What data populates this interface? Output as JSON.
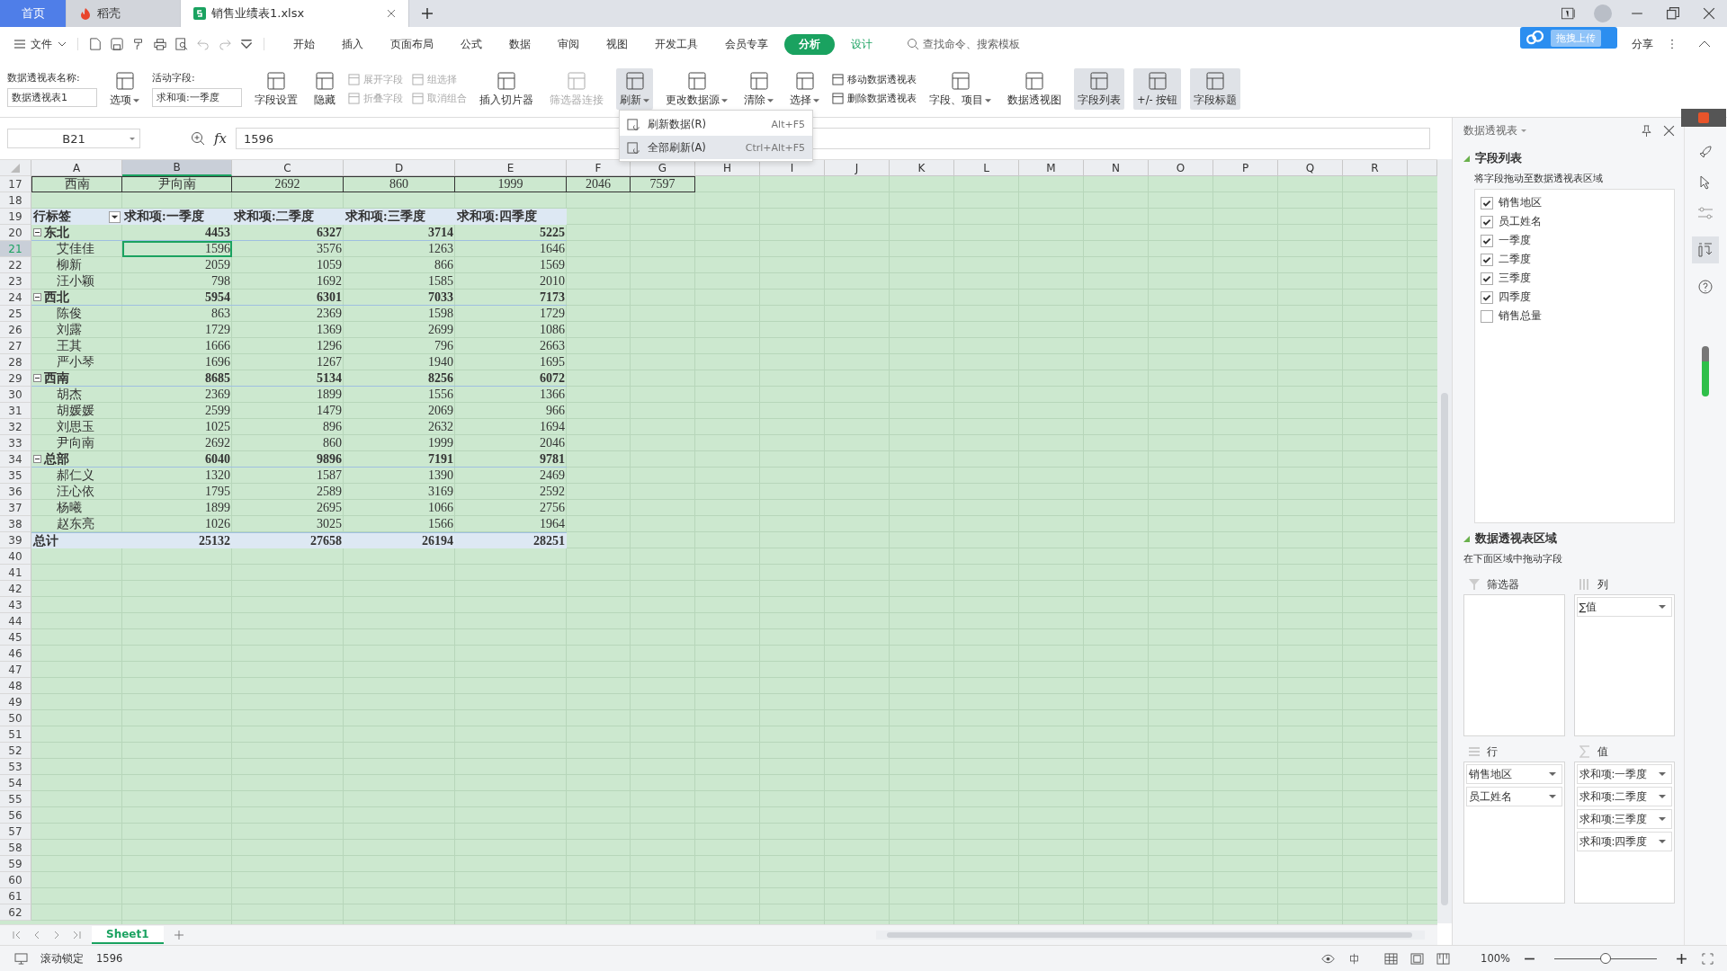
{
  "tabs": [
    {
      "label": "首页",
      "selected": false,
      "kind": "home"
    },
    {
      "label": "稻壳",
      "selected": false,
      "kind": "docer"
    },
    {
      "label": "销售业绩表1.xlsx",
      "selected": true,
      "kind": "sheet"
    }
  ],
  "menu": {
    "file": "文件",
    "items": [
      {
        "label": "开始",
        "selected": false,
        "contextual": false
      },
      {
        "label": "插入",
        "selected": false,
        "contextual": false
      },
      {
        "label": "页面布局",
        "selected": false,
        "contextual": false
      },
      {
        "label": "公式",
        "selected": false,
        "contextual": false
      },
      {
        "label": "数据",
        "selected": false,
        "contextual": false
      },
      {
        "label": "审阅",
        "selected": false,
        "contextual": false
      },
      {
        "label": "视图",
        "selected": false,
        "contextual": false
      },
      {
        "label": "开发工具",
        "selected": false,
        "contextual": false
      },
      {
        "label": "会员专享",
        "selected": false,
        "contextual": false
      },
      {
        "label": "分析",
        "selected": true,
        "contextual": true
      },
      {
        "label": "设计",
        "selected": false,
        "contextual": true
      }
    ],
    "search": "查找命令、搜索模板",
    "share": "分享",
    "upload": "拖拽上传"
  },
  "ribbon": [
    {
      "kind": "name",
      "label": "数据透视表名称:",
      "value": "数据透视表1"
    },
    {
      "kind": "big",
      "label": "选项",
      "dropdown": true,
      "disabled": false,
      "selected": false
    },
    {
      "kind": "name",
      "label": "活动字段:",
      "value": "求和项:一季度"
    },
    {
      "kind": "big",
      "label": "字段设置",
      "dropdown": false,
      "disabled": false,
      "selected": false
    },
    {
      "kind": "big",
      "label": "隐藏",
      "dropdown": false,
      "disabled": false,
      "selected": false
    },
    {
      "kind": "stack",
      "items": [
        {
          "label": "展开字段",
          "disabled": true
        },
        {
          "label": "折叠字段",
          "disabled": true
        }
      ]
    },
    {
      "kind": "stack",
      "items": [
        {
          "label": "组选择",
          "disabled": true
        },
        {
          "label": "取消组合",
          "disabled": true
        }
      ]
    },
    {
      "kind": "big",
      "label": "插入切片器",
      "dropdown": false,
      "disabled": false,
      "selected": false
    },
    {
      "kind": "big",
      "label": "筛选器连接",
      "dropdown": false,
      "disabled": true,
      "selected": false
    },
    {
      "kind": "big",
      "label": "刷新",
      "dropdown": true,
      "disabled": false,
      "selected": true
    },
    {
      "kind": "big",
      "label": "更改数据源",
      "dropdown": true,
      "disabled": false,
      "selected": false
    },
    {
      "kind": "big",
      "label": "清除",
      "dropdown": true,
      "disabled": false,
      "selected": false
    },
    {
      "kind": "big",
      "label": "选择",
      "dropdown": true,
      "disabled": false,
      "selected": false
    },
    {
      "kind": "stack",
      "items": [
        {
          "label": "移动数据透视表",
          "disabled": false
        },
        {
          "label": "删除数据透视表",
          "disabled": false
        }
      ]
    },
    {
      "kind": "big",
      "label": "字段、项目",
      "dropdown": true,
      "disabled": false,
      "selected": false
    },
    {
      "kind": "big",
      "label": "数据透视图",
      "dropdown": false,
      "disabled": false,
      "selected": false
    },
    {
      "kind": "big",
      "label": "字段列表",
      "dropdown": false,
      "disabled": false,
      "selected": true
    },
    {
      "kind": "big",
      "label": "+/- 按钮",
      "dropdown": false,
      "disabled": false,
      "selected": true
    },
    {
      "kind": "big",
      "label": "字段标题",
      "dropdown": false,
      "disabled": false,
      "selected": true
    }
  ],
  "refresh_menu": [
    {
      "label": "刷新数据(R)",
      "shortcut": "Alt+F5",
      "selected": false
    },
    {
      "label": "全部刷新(A)",
      "shortcut": "Ctrl+Alt+F5",
      "selected": true
    }
  ],
  "formula_bar": {
    "cell": "B21",
    "function_label": "fx",
    "value": "1596"
  },
  "sheet": {
    "columns": [
      {
        "label": "A",
        "selected": false
      },
      {
        "label": "B",
        "selected": true
      },
      {
        "label": "C",
        "selected": false
      },
      {
        "label": "D",
        "selected": false
      },
      {
        "label": "E",
        "selected": false
      },
      {
        "label": "F",
        "selected": false
      },
      {
        "label": "G",
        "selected": false
      },
      {
        "label": "H",
        "selected": false
      },
      {
        "label": "I",
        "selected": false
      },
      {
        "label": "J",
        "selected": false
      },
      {
        "label": "K",
        "selected": false
      },
      {
        "label": "L",
        "selected": false
      },
      {
        "label": "M",
        "selected": false
      },
      {
        "label": "N",
        "selected": false
      },
      {
        "label": "O",
        "selected": false
      },
      {
        "label": "P",
        "selected": false
      },
      {
        "label": "Q",
        "selected": false
      },
      {
        "label": "R",
        "selected": false
      }
    ],
    "rows": [
      {
        "number": "17",
        "kind": "plain",
        "selected": false,
        "cells": [
          "西南",
          "尹向南",
          "2692",
          "860",
          "1999",
          "2046",
          "7597"
        ]
      },
      {
        "number": "18",
        "kind": "empty",
        "selected": false
      },
      {
        "number": "19",
        "kind": "header",
        "selected": false,
        "cells": [
          "行标签",
          "求和项:一季度",
          "求和项:二季度",
          "求和项:三季度",
          "求和项:四季度"
        ]
      },
      {
        "number": "20",
        "kind": "group",
        "selected": false,
        "expanded": true,
        "cells": [
          "东北",
          "4453",
          "6327",
          "3714",
          "5225"
        ]
      },
      {
        "number": "21",
        "kind": "item",
        "selected": true,
        "cells": [
          "艾佳佳",
          "1596",
          "3576",
          "1263",
          "1646"
        ]
      },
      {
        "number": "22",
        "kind": "item",
        "selected": false,
        "cells": [
          "柳新",
          "2059",
          "1059",
          "866",
          "1569"
        ]
      },
      {
        "number": "23",
        "kind": "item",
        "selected": false,
        "cells": [
          "汪小颖",
          "798",
          "1692",
          "1585",
          "2010"
        ]
      },
      {
        "number": "24",
        "kind": "group",
        "selected": false,
        "expanded": true,
        "cells": [
          "西北",
          "5954",
          "6301",
          "7033",
          "7173"
        ]
      },
      {
        "number": "25",
        "kind": "item",
        "selected": false,
        "cells": [
          "陈俊",
          "863",
          "2369",
          "1598",
          "1729"
        ]
      },
      {
        "number": "26",
        "kind": "item",
        "selected": false,
        "cells": [
          "刘露",
          "1729",
          "1369",
          "2699",
          "1086"
        ]
      },
      {
        "number": "27",
        "kind": "item",
        "selected": false,
        "cells": [
          "王其",
          "1666",
          "1296",
          "796",
          "2663"
        ]
      },
      {
        "number": "28",
        "kind": "item",
        "selected": false,
        "cells": [
          "严小琴",
          "1696",
          "1267",
          "1940",
          "1695"
        ]
      },
      {
        "number": "29",
        "kind": "group",
        "selected": false,
        "expanded": true,
        "cells": [
          "西南",
          "8685",
          "5134",
          "8256",
          "6072"
        ]
      },
      {
        "number": "30",
        "kind": "item",
        "selected": false,
        "cells": [
          "胡杰",
          "2369",
          "1899",
          "1556",
          "1366"
        ]
      },
      {
        "number": "31",
        "kind": "item",
        "selected": false,
        "cells": [
          "胡媛媛",
          "2599",
          "1479",
          "2069",
          "966"
        ]
      },
      {
        "number": "32",
        "kind": "item",
        "selected": false,
        "cells": [
          "刘思玉",
          "1025",
          "896",
          "2632",
          "1694"
        ]
      },
      {
        "number": "33",
        "kind": "item",
        "selected": false,
        "cells": [
          "尹向南",
          "2692",
          "860",
          "1999",
          "2046"
        ]
      },
      {
        "number": "34",
        "kind": "group",
        "selected": false,
        "expanded": true,
        "cells": [
          "总部",
          "6040",
          "9896",
          "7191",
          "9781"
        ]
      },
      {
        "number": "35",
        "kind": "item",
        "selected": false,
        "cells": [
          "郝仁义",
          "1320",
          "1587",
          "1390",
          "2469"
        ]
      },
      {
        "number": "36",
        "kind": "item",
        "selected": false,
        "cells": [
          "汪心依",
          "1795",
          "2589",
          "3169",
          "2592"
        ]
      },
      {
        "number": "37",
        "kind": "item",
        "selected": false,
        "cells": [
          "杨曦",
          "1899",
          "2695",
          "1066",
          "2756"
        ]
      },
      {
        "number": "38",
        "kind": "item",
        "selected": false,
        "cells": [
          "赵东亮",
          "1026",
          "3025",
          "1566",
          "1964"
        ]
      },
      {
        "number": "39",
        "kind": "total",
        "selected": false,
        "cells": [
          "总计",
          "25132",
          "27658",
          "26194",
          "28251"
        ]
      },
      {
        "number": "40",
        "kind": "empty",
        "selected": false
      },
      {
        "number": "41",
        "kind": "empty",
        "selected": false
      },
      {
        "number": "42",
        "kind": "empty",
        "selected": false
      },
      {
        "number": "43",
        "kind": "empty",
        "selected": false
      },
      {
        "number": "44",
        "kind": "empty",
        "selected": false
      },
      {
        "number": "45",
        "kind": "empty",
        "selected": false
      },
      {
        "number": "46",
        "kind": "empty",
        "selected": false
      },
      {
        "number": "47",
        "kind": "empty",
        "selected": false
      },
      {
        "number": "48",
        "kind": "empty",
        "selected": false
      },
      {
        "number": "49",
        "kind": "empty",
        "selected": false
      },
      {
        "number": "50",
        "kind": "empty",
        "selected": false
      },
      {
        "number": "51",
        "kind": "empty",
        "selected": false
      },
      {
        "number": "52",
        "kind": "empty",
        "selected": false
      },
      {
        "number": "53",
        "kind": "empty",
        "selected": false
      },
      {
        "number": "54",
        "kind": "empty",
        "selected": false
      },
      {
        "number": "55",
        "kind": "empty",
        "selected": false
      },
      {
        "number": "56",
        "kind": "empty",
        "selected": false
      },
      {
        "number": "57",
        "kind": "empty",
        "selected": false
      },
      {
        "number": "58",
        "kind": "empty",
        "selected": false
      },
      {
        "number": "59",
        "kind": "empty",
        "selected": false
      },
      {
        "number": "60",
        "kind": "empty",
        "selected": false
      },
      {
        "number": "61",
        "kind": "empty",
        "selected": false
      },
      {
        "number": "62",
        "kind": "empty",
        "selected": false
      }
    ],
    "sheet_tabs": [
      {
        "label": "Sheet1",
        "selected": true
      }
    ]
  },
  "panel": {
    "title": "数据透视表",
    "field_list": {
      "heading": "字段列表",
      "hint": "将字段拖动至数据透视表区域",
      "fields": [
        {
          "label": "销售地区",
          "checked": true
        },
        {
          "label": "员工姓名",
          "checked": true
        },
        {
          "label": "一季度",
          "checked": true
        },
        {
          "label": "二季度",
          "checked": true
        },
        {
          "label": "三季度",
          "checked": true
        },
        {
          "label": "四季度",
          "checked": true
        },
        {
          "label": "销售总量",
          "checked": false
        }
      ]
    },
    "areas": {
      "heading": "数据透视表区域",
      "hint": "在下面区域中拖动字段",
      "filters": {
        "label": "筛选器"
      },
      "columns": {
        "label": "列",
        "items": [
          "∑值"
        ]
      },
      "rows": {
        "label": "行",
        "items": [
          "销售地区",
          "员工姓名"
        ]
      },
      "values": {
        "label": "值",
        "items": [
          "求和项:一季度",
          "求和项:二季度",
          "求和项:三季度",
          "求和项:四季度"
        ]
      }
    }
  },
  "status_bar": {
    "mode": "滚动锁定",
    "value": "1596",
    "zoom": "100%",
    "level": 0.5
  }
}
